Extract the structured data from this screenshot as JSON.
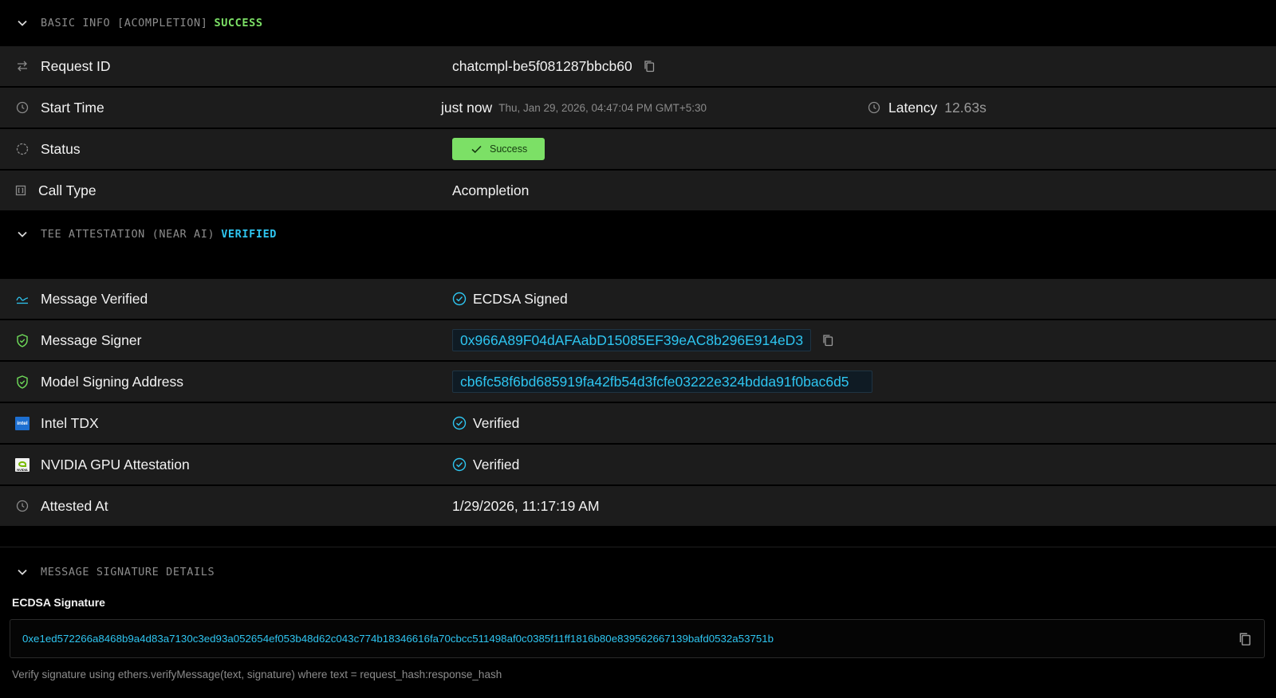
{
  "basic_info": {
    "title": "BASIC INFO [ACOMPLETION]",
    "badge": "SUCCESS",
    "request_id": {
      "label": "Request ID",
      "value": "chatcmpl-be5f081287bbcb60"
    },
    "start_time": {
      "label": "Start Time",
      "relative": "just now",
      "absolute": "Thu, Jan 29, 2026, 04:47:04 PM GMT+5:30",
      "latency_label": "Latency",
      "latency_value": "12.63s"
    },
    "status": {
      "label": "Status",
      "value": "Success"
    },
    "call_type": {
      "label": "Call Type",
      "value": "Acompletion"
    }
  },
  "tee": {
    "title": "TEE ATTESTATION (NEAR AI)",
    "badge": "VERIFIED",
    "message_verified": {
      "label": "Message Verified",
      "value": "ECDSA Signed"
    },
    "message_signer": {
      "label": "Message Signer",
      "value": "0x966A89F04dAFAabD15085EF39eAC8b296E914eD3"
    },
    "model_signing_address": {
      "label": "Model Signing Address",
      "value": "cb6fc58f6bd685919fa42fb54d3fcfe03222e324bdda91f0bac6d5"
    },
    "intel_tdx": {
      "label": "Intel TDX",
      "value": "Verified",
      "icon_text": "intel"
    },
    "nvidia": {
      "label": "NVIDIA GPU Attestation",
      "value": "Verified",
      "icon_text": "NVIDIA"
    },
    "attested_at": {
      "label": "Attested At",
      "value": "1/29/2026, 11:17:19 AM"
    }
  },
  "signature": {
    "title": "MESSAGE SIGNATURE DETAILS",
    "label": "ECDSA Signature",
    "value": "0xe1ed572266a8468b9a4d83a7130c3ed93a052654ef053b48d62c043c774b18346616fa70cbcc511498af0c0385f11ff1816b80e839562667139bafd0532a53751b",
    "hint": "Verify signature using ethers.verifyMessage(text, signature) where text = request_hash:response_hash"
  },
  "colors": {
    "success_green": "#7ce066",
    "verified_cyan": "#2ec5f0",
    "row_bg": "#1c1c1c"
  },
  "icons": [
    "chevron-down-icon",
    "arrows-swap-icon",
    "clock-icon",
    "status-circle-icon",
    "code-bracket-icon",
    "check-icon",
    "copy-icon",
    "trend-icon",
    "shield-check-icon",
    "check-circle-icon",
    "intel-logo-icon",
    "nvidia-logo-icon"
  ]
}
